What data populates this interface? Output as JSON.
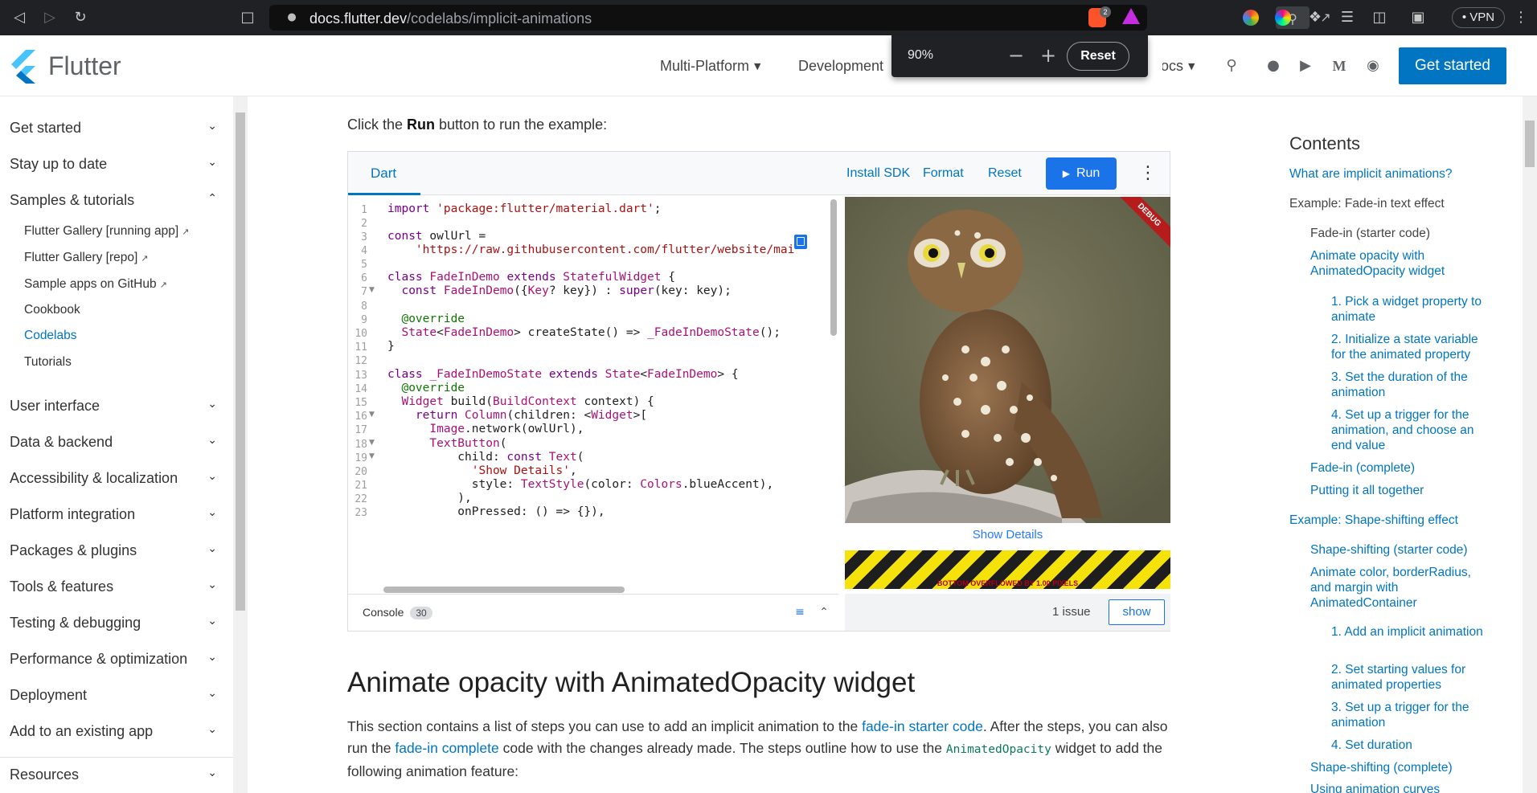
{
  "browser": {
    "url_host": "docs.flutter.dev",
    "url_path": "/codelabs/implicit-animations",
    "vpn_label": "VPN",
    "brave_badge": "2"
  },
  "zoom_popup": {
    "level": "90%",
    "reset_label": "Reset"
  },
  "header": {
    "logo_text": "Flutter",
    "nav": [
      "Multi-Platform",
      "Development",
      "Docs"
    ],
    "get_started": "Get started"
  },
  "sidebar": {
    "items": [
      {
        "label": "Get started",
        "expanded": false
      },
      {
        "label": "Stay up to date",
        "expanded": false
      },
      {
        "label": "Samples & tutorials",
        "expanded": true
      },
      {
        "label": "User interface",
        "expanded": false
      },
      {
        "label": "Data & backend",
        "expanded": false
      },
      {
        "label": "Accessibility & localization",
        "expanded": false
      },
      {
        "label": "Platform integration",
        "expanded": false
      },
      {
        "label": "Packages & plugins",
        "expanded": false
      },
      {
        "label": "Tools & features",
        "expanded": false
      },
      {
        "label": "Testing & debugging",
        "expanded": false
      },
      {
        "label": "Performance & optimization",
        "expanded": false
      },
      {
        "label": "Deployment",
        "expanded": false
      },
      {
        "label": "Add to an existing app",
        "expanded": false
      },
      {
        "label": "Resources",
        "expanded": false
      }
    ],
    "sub_items": [
      {
        "label": "Flutter Gallery [running app]",
        "external": true
      },
      {
        "label": "Flutter Gallery [repo]",
        "external": true
      },
      {
        "label": "Sample apps on GitHub",
        "external": true
      },
      {
        "label": "Cookbook",
        "external": false
      },
      {
        "label": "Codelabs",
        "external": false,
        "active": true
      },
      {
        "label": "Tutorials",
        "external": false
      }
    ]
  },
  "content": {
    "intro_prefix": "Click the ",
    "intro_bold": "Run",
    "intro_suffix": " button to run the example:",
    "section_heading": "Animate opacity with AnimatedOpacity widget",
    "para": {
      "t1": "This section contains a list of steps you can use to add an implicit animation to the ",
      "link1": "fade-in starter code",
      "t2": ". After the steps, you can also run the ",
      "link2": "fade-in complete",
      "t3": " code with the changes already made. The steps outline how to use the ",
      "code": "AnimatedOpacity",
      "t4": " widget to add the following animation feature:"
    }
  },
  "dartpad": {
    "tab": "Dart",
    "install_sdk": "Install SDK",
    "format": "Format",
    "reset": "Reset",
    "run": "Run",
    "console_label": "Console",
    "console_count": "30",
    "show_details": "Show Details",
    "overflow_text": "BOTTOM OVERFLOWED BY 1.00 PIXELS",
    "debug_label": "DEBUG",
    "issue_text": "1 issue",
    "show_label": "show",
    "line_numbers": [
      "1",
      "2",
      "3",
      "4",
      "5",
      "6",
      "7",
      "8",
      "9",
      "10",
      "11",
      "12",
      "13",
      "14",
      "15",
      "16",
      "17",
      "18",
      "19",
      "20",
      "21",
      "22",
      "23"
    ]
  },
  "toc": {
    "title": "Contents",
    "links": [
      "What are implicit animations?",
      "Example: Fade-in text effect",
      "Fade-in (starter code)",
      "Animate opacity with AnimatedOpacity widget",
      "1. Pick a widget property to animate",
      "2. Initialize a state variable for the animated property",
      "3. Set the duration of the animation",
      "4. Set up a trigger for the animation, and choose an end value",
      "Fade-in (complete)",
      "Putting it all together",
      "Example: Shape-shifting effect",
      "Shape-shifting (starter code)",
      "Animate color, borderRadius, and margin with AnimatedContainer",
      "1. Add an implicit animation",
      "2. Set starting values for animated properties",
      "3. Set up a trigger for the animation",
      "4. Set duration",
      "Shape-shifting (complete)",
      "Using animation curves"
    ]
  }
}
